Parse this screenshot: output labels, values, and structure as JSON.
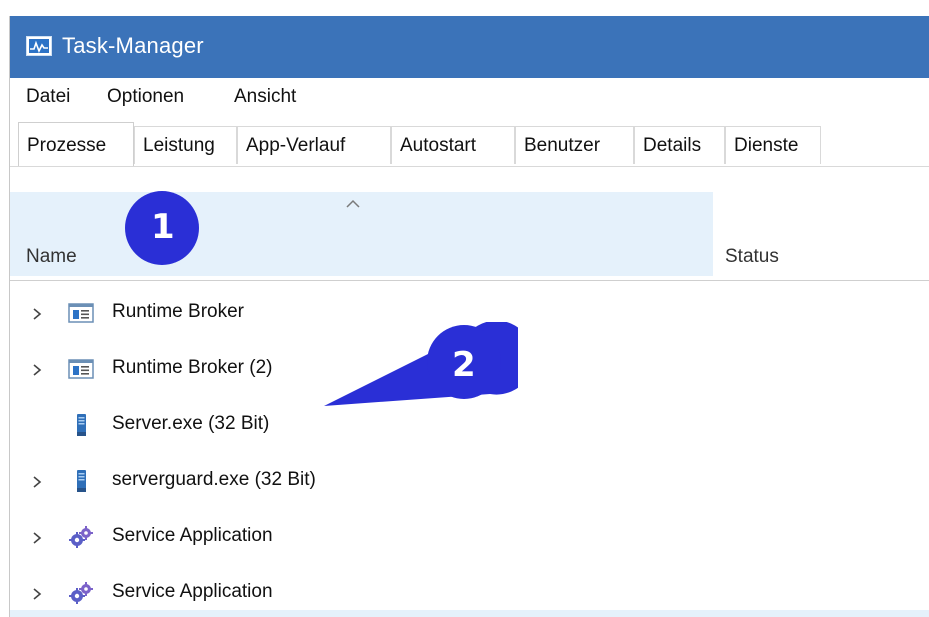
{
  "window": {
    "title": "Task-Manager"
  },
  "menu": [
    "Datei",
    "Optionen",
    "Ansicht"
  ],
  "tabs": [
    "Prozesse",
    "Leistung",
    "App-Verlauf",
    "Autostart",
    "Benutzer",
    "Details",
    "Dienste"
  ],
  "active_tab": "Prozesse",
  "columns": {
    "name": "Name",
    "status": "Status"
  },
  "rows": [
    {
      "label": "Runtime Broker",
      "icon": "window-app-icon",
      "expandable": true
    },
    {
      "label": "Runtime Broker (2)",
      "icon": "window-app-icon",
      "expandable": true
    },
    {
      "label": "Server.exe (32 Bit)",
      "icon": "server-icon",
      "expandable": false
    },
    {
      "label": "serverguard.exe (32 Bit)",
      "icon": "server-icon",
      "expandable": true
    },
    {
      "label": "Service Application",
      "icon": "gears-icon",
      "expandable": true
    },
    {
      "label": "Service Application",
      "icon": "gears-icon",
      "expandable": true
    }
  ],
  "annotations": {
    "marker1": "1",
    "marker2": "2"
  },
  "colors": {
    "titlebar": "#3b73b9",
    "header_highlight": "#e5f1fb",
    "marker": "#2a2fd6"
  }
}
